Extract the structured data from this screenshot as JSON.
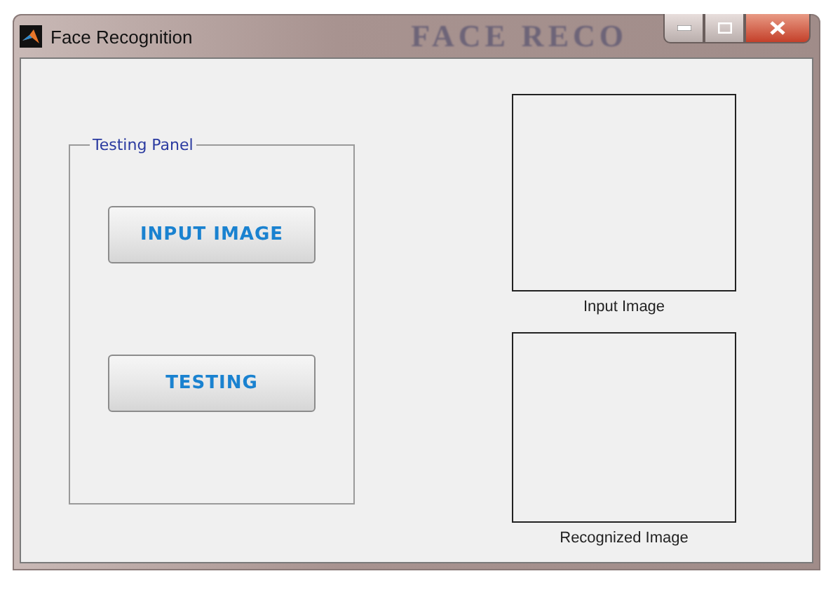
{
  "window": {
    "title": "Face Recognition",
    "backdrop_text": "FACE RECO"
  },
  "panel": {
    "title": "Testing Panel",
    "buttons": [
      {
        "label": "INPUT IMAGE"
      },
      {
        "label": "TESTING"
      }
    ]
  },
  "axes": [
    {
      "label": "Input Image"
    },
    {
      "label": "Recognized Image"
    }
  ]
}
